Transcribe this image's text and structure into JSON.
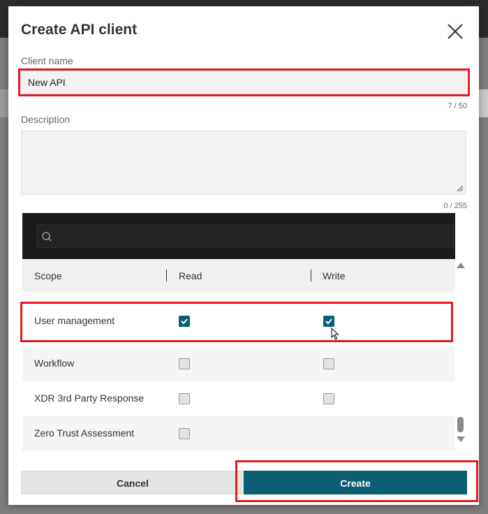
{
  "dialog": {
    "title": "Create API client",
    "close_icon": "close-icon"
  },
  "client_name": {
    "label": "Client name",
    "value": "New API",
    "counter": "7 / 50"
  },
  "description": {
    "label": "Description",
    "value": "",
    "counter": "0 / 255"
  },
  "scope_search": {
    "value": "",
    "icon": "search-icon"
  },
  "scope_table": {
    "headers": {
      "scope": "Scope",
      "read": "Read",
      "write": "Write"
    },
    "rows": [
      {
        "scope": "User management",
        "read": true,
        "write": true
      },
      {
        "scope": "Workflow",
        "read": false,
        "write": false
      },
      {
        "scope": "XDR 3rd Party Response",
        "read": false,
        "write": false
      },
      {
        "scope": "Zero Trust Assessment",
        "read": false,
        "write": null
      }
    ]
  },
  "buttons": {
    "cancel": "Cancel",
    "create": "Create"
  },
  "colors": {
    "accent": "#0b5f75",
    "highlight": "#e21b23",
    "search_bar": "#1b1b1b"
  }
}
